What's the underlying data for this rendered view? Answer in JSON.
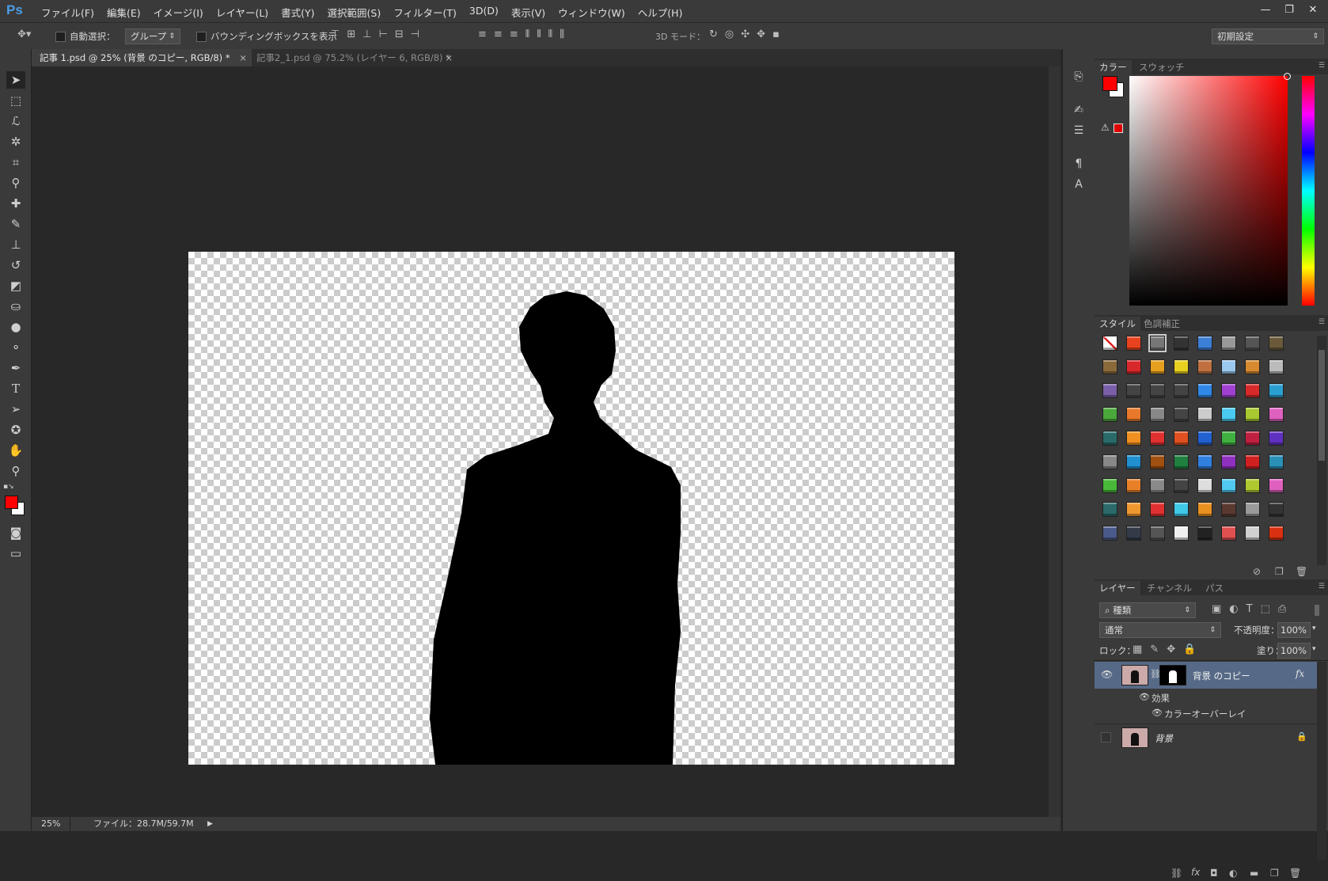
{
  "app": {
    "logo": "Ps"
  },
  "menu": [
    "ファイル(F)",
    "編集(E)",
    "イメージ(I)",
    "レイヤー(L)",
    "書式(Y)",
    "選択範囲(S)",
    "フィルター(T)",
    "3D(D)",
    "表示(V)",
    "ウィンドウ(W)",
    "ヘルプ(H)"
  ],
  "window_controls": {
    "minimize": "—",
    "restore": "❐",
    "close": "✕"
  },
  "options": {
    "auto_select_label": "自動選択：",
    "auto_select_value": "グループ",
    "bounding_box_label": "バウンディングボックスを表示",
    "mode_3d_label": "3D モード：",
    "workspace": "初期設定"
  },
  "tabs": [
    {
      "label": "記事 1.psd @ 25% (背景 のコピー, RGB/8) *",
      "close": "×"
    },
    {
      "label": "記事2_1.psd @ 75.2% (レイヤー 6, RGB/8) *",
      "close": "×"
    }
  ],
  "status": {
    "zoom": "25%",
    "file_info": "ファイル：28.7M/59.7M",
    "arrow": "▶"
  },
  "colors": {
    "foreground": "#ff0000",
    "background": "#ffffff",
    "accent": "#4b9ee6"
  },
  "color_panel": {
    "tabs": [
      "カラー",
      "スウォッチ"
    ],
    "warning_icon": "⚠"
  },
  "styles_panel": {
    "tabs": [
      "スタイル",
      "色調補正"
    ],
    "swatches": [
      [
        "#ffffff",
        "#e8421e",
        "#777777",
        "#333333",
        "#3c7fd6",
        "#999999",
        "#555555",
        "#6a5a3a"
      ],
      [
        "#8a6a3a",
        "#d8282a",
        "#e6a01e",
        "#e8d020",
        "#c07040",
        "#9ac8ee",
        "#d88a30",
        "#bbbbbb"
      ],
      [
        "#7a5fa8",
        "#444444",
        "#444444",
        "#444444",
        "#2f88e8",
        "#a040d0",
        "#d82a2a",
        "#2aa0d0"
      ],
      [
        "#4aa83a",
        "#e8782a",
        "#888888",
        "#444444",
        "#cccccc",
        "#4ac8f0",
        "#a8c830",
        "#e060c0"
      ],
      [
        "#2a6a6a",
        "#f09020",
        "#e03030",
        "#e05020",
        "#2060d0",
        "#40b040",
        "#c02040",
        "#6030c0"
      ],
      [
        "#888888",
        "#2090d0",
        "#a05010",
        "#208040",
        "#3080e0",
        "#9030c0",
        "#d02020",
        "#2a90b8"
      ],
      [
        "#48b838",
        "#e88028",
        "#8a8a8a",
        "#444444",
        "#dddddd",
        "#50c8f0",
        "#b0c830",
        "#e060c0"
      ],
      [
        "#2a6a6a",
        "#f09830",
        "#e03030",
        "#40c8e8",
        "#e89020",
        "#5a3a30",
        "#9a9a9a",
        "#333333"
      ],
      [
        "#4a5a8a",
        "#333a48",
        "#555555",
        "#f0f0f0",
        "#222222",
        "#e05050",
        "#d0d0d0",
        "#d83010"
      ]
    ]
  },
  "layers_panel": {
    "tabs": [
      "レイヤー",
      "チャンネル",
      "パス"
    ],
    "filter_label": "種類",
    "blend_mode": "通常",
    "opacity_label": "不透明度：",
    "opacity_value": "100%",
    "lock_label": "ロック：",
    "fill_label": "塗り：",
    "fill_value": "100%",
    "layers": [
      {
        "name": "背景 のコピー",
        "fx": "fx",
        "effects_label": "効果",
        "effect": "カラーオーバーレイ"
      },
      {
        "name": "背景"
      }
    ]
  }
}
